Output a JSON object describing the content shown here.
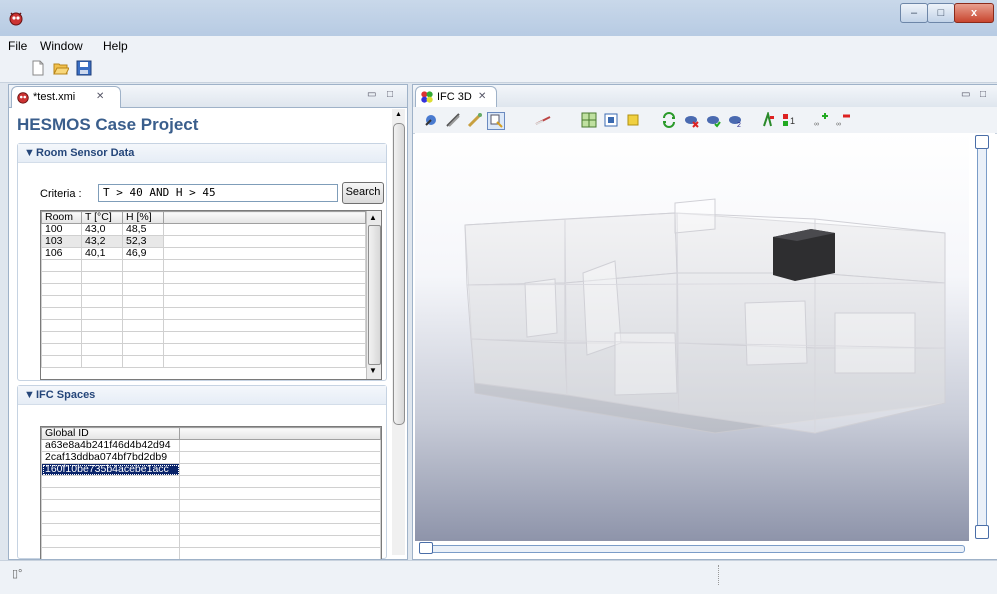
{
  "window": {
    "minimize": "–",
    "maximize": "□",
    "close": "x"
  },
  "menu": {
    "file": "File",
    "window": "Window",
    "help": "Help"
  },
  "left_editor": {
    "tab_label": "*test.xmi",
    "form_title": "HESMOS Case Project",
    "room_sensor": {
      "header": "Room Sensor Data",
      "criteria_label": "Criteria :",
      "criteria_value": "T > 40 AND H > 45",
      "search_label": "Search",
      "columns": [
        "Room",
        "T [°C]",
        "H [%]"
      ],
      "rows": [
        [
          "100",
          "43,0",
          "48,5"
        ],
        [
          "103",
          "43,2",
          "52,3"
        ],
        [
          "106",
          "40,1",
          "46,9"
        ]
      ]
    },
    "ifc_spaces": {
      "header": "IFC Spaces",
      "columns": [
        "Global ID"
      ],
      "rows": [
        "a63e8a4b241f46d4b42d94",
        "2caf13ddba074bf7bd2db9",
        "160f10be735b4acebe1acc"
      ],
      "selected_index": 2
    }
  },
  "right_view": {
    "tab_label": "IFC 3D"
  },
  "icons": [
    "app-icon",
    "new-file-icon",
    "open-folder-icon",
    "save-icon",
    "editor-tab-icon",
    "view-tab-icon",
    "close-tab-icon",
    "minimize-view-icon",
    "maximize-view-icon",
    "view-menu-icon",
    "fast-view-icon"
  ],
  "colors": {
    "selection": "#0a246a",
    "title_text": "#3a5e8c",
    "section_header": "#25467a"
  }
}
